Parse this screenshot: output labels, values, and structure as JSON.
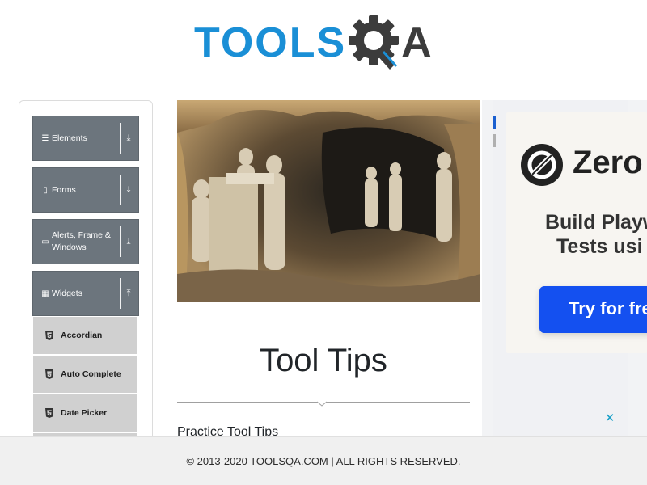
{
  "header": {
    "logo_text_blue": "TOOLS",
    "logo_text_dark": "A",
    "logo_gear_icon": "gear-icon",
    "brand_color": "#1a8fd6"
  },
  "sidebar": {
    "groups": [
      {
        "label": "Elements",
        "icon": "hamburger-icon",
        "arrow": "download-icon"
      },
      {
        "label": "Forms",
        "icon": "document-icon",
        "arrow": "download-icon"
      },
      {
        "label": "Alerts, Frame & Windows",
        "icon": "window-icon",
        "arrow": "download-icon"
      },
      {
        "label": "Widgets",
        "icon": "grid-icon",
        "arrow": "upload-icon"
      }
    ],
    "sub_items": [
      {
        "label": "Accordian",
        "icon": "html5-icon"
      },
      {
        "label": "Auto Complete",
        "icon": "html5-icon"
      },
      {
        "label": "Date Picker",
        "icon": "html5-icon"
      }
    ],
    "group_color": "#6c757d",
    "sub_color": "#d0d0d0"
  },
  "main": {
    "title": "Tool Tips",
    "subtitle": "Practice Tool Tips"
  },
  "ad": {
    "brand": "Zero",
    "line1": "Build Playw",
    "line2": "Tests usi",
    "button_label": "Try for fre",
    "button_color": "#1450f0",
    "close_label": "✕"
  },
  "footer": {
    "text": "© 2013-2020 TOOLSQA.COM | ALL RIGHTS RESERVED."
  }
}
